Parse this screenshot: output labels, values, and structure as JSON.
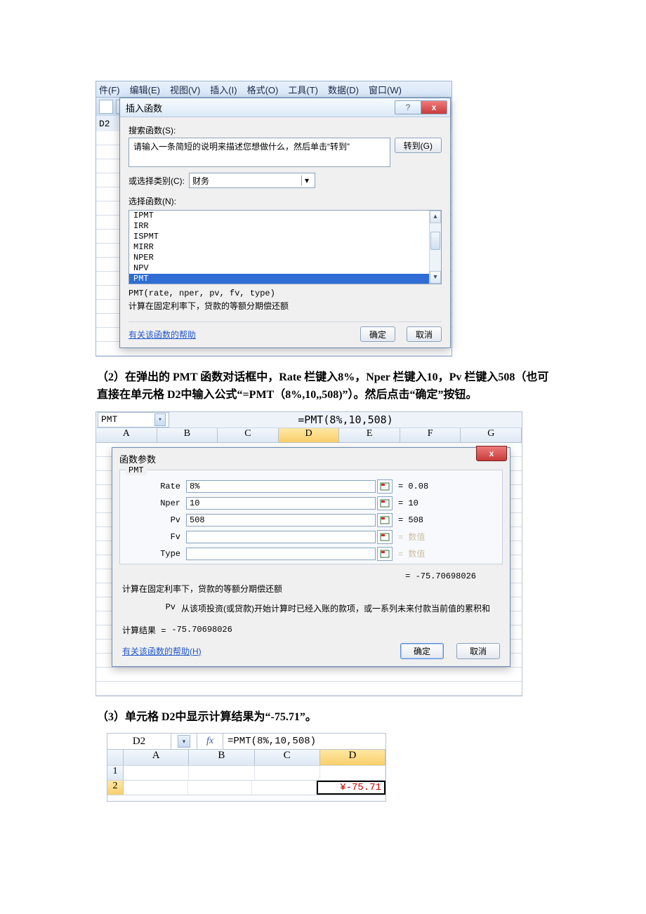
{
  "menus": [
    "件(F)",
    "编辑(E)",
    "视图(V)",
    "插入(I)",
    "格式(O)",
    "工具(T)",
    "数据(D)",
    "窗口(W)"
  ],
  "name_box_d2": "D2",
  "dialog1": {
    "title": "插入函数",
    "help_glyph": "?",
    "close_glyph": "x",
    "search_label": "搜索函数(S):",
    "search_placeholder": "请输入一条简短的说明来描述您想做什么，然后单击“转到”",
    "go_btn": "转到(G)",
    "category_label": "或选择类别(C):",
    "category_value": "财务",
    "select_label": "选择函数(N):",
    "options": [
      "IPMT",
      "IRR",
      "ISPMT",
      "MIRR",
      "NPER",
      "NPV",
      "PMT"
    ],
    "selected_index": 6,
    "signature": "PMT(rate, nper, pv, fv, type)",
    "description": "计算在固定利率下，贷款的等额分期偿还额",
    "help_link": "有关该函数的帮助",
    "ok": "确定",
    "cancel": "取消"
  },
  "para2": "（2）在弹出的 PMT 函数对话框中，Rate 栏键入8%，Nper 栏键入10，Pv 栏键入508（也可直接在单元格 D2中输入公式“=PMT（8%,10,,508)”）。然后点击“确定”按钮。",
  "fig2": {
    "name_box": "PMT",
    "formula": "=PMT(8%,10,508)",
    "cols": [
      "A",
      "B",
      "C",
      "D",
      "E",
      "F",
      "G"
    ],
    "selected_col_index": 3,
    "dialog": {
      "title": "函数参数",
      "close_glyph": "x",
      "fn_name": "PMT",
      "args": [
        {
          "label": "Rate",
          "value": "8%",
          "eq": "= 0.08",
          "dim": false
        },
        {
          "label": "Nper",
          "value": "10",
          "eq": "= 10",
          "dim": false
        },
        {
          "label": "Pv",
          "value": "508",
          "eq": "= 508",
          "dim": false
        },
        {
          "label": "Fv",
          "value": "",
          "eq": "= 数值",
          "dim": true
        },
        {
          "label": "Type",
          "value": "",
          "eq": "= 数值",
          "dim": true
        }
      ],
      "result_eq": "= -75.70698026",
      "desc": "计算在固定利率下，贷款的等额分期偿还额",
      "pv_label": "Pv",
      "pv_text": "从该项投资(或贷款)开始计算时已经入账的款项，或一系列未来付款当前值的累积和",
      "calc_label": "计算结果 =",
      "calc_value": "-75.70698026",
      "help_link": "有关该函数的帮助(H)",
      "ok": "确定",
      "cancel": "取消"
    }
  },
  "para3": "（3）单元格 D2中显示计算结果为“-75.71”。",
  "fig3": {
    "name_box": "D2",
    "fx": "fx",
    "formula": "=PMT(8%,10,508)",
    "cols": [
      "A",
      "B",
      "C",
      "D"
    ],
    "selected_col_index": 3,
    "rows": [
      "1",
      "2"
    ],
    "result_cell": "¥-75.71"
  }
}
